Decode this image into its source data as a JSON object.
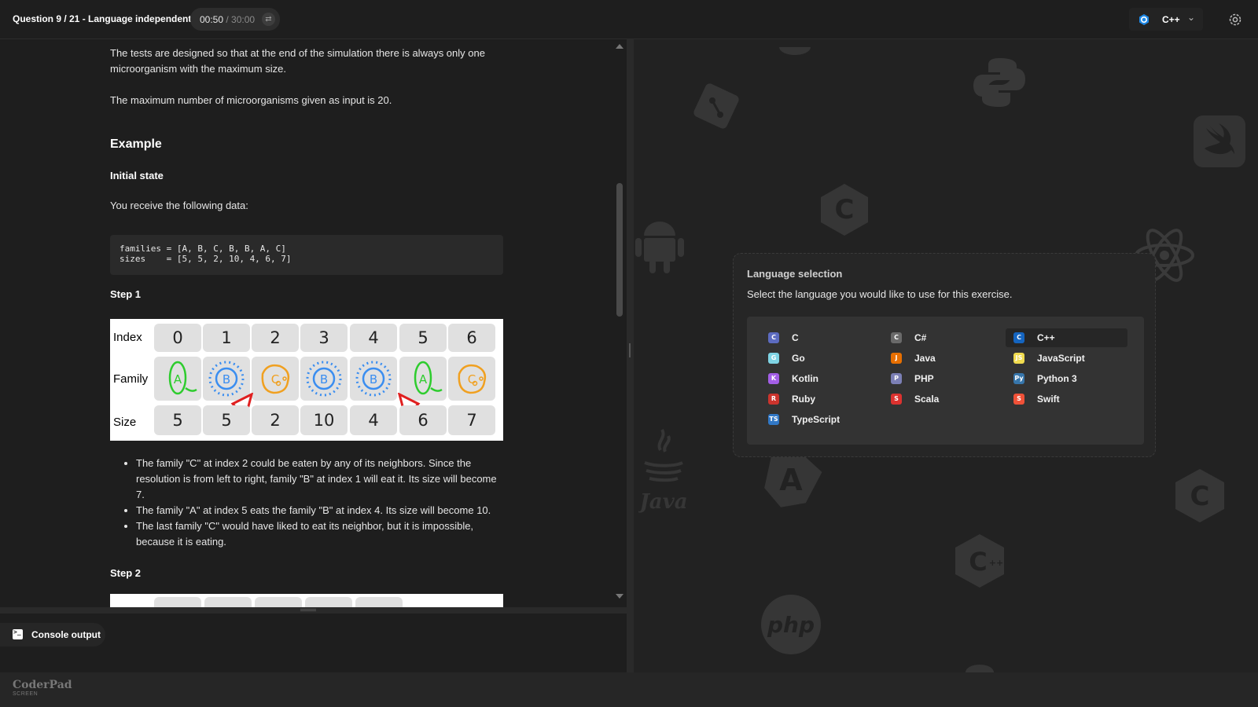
{
  "header": {
    "question_title": "Question 9 / 21 - Language independent",
    "timer_elapsed": "00:50",
    "timer_total": " / 30:00",
    "selected_language": "C++"
  },
  "problem": {
    "p1": "The tests are designed so that at the end of the simulation there is always only one microorganism with the maximum size.",
    "p2": "The maximum number of microorganisms given as input is 20.",
    "example_heading": "Example",
    "initial_state_heading": "Initial state",
    "p3": "You receive the following data:",
    "code_line1": "families = [A, B, C, B, B, A, C]",
    "code_line2": "sizes    = [5, 5, 2, 10, 4, 6, 7]",
    "step1_heading": "Step 1",
    "figure": {
      "row_labels": [
        "Index",
        "Family",
        "Size"
      ],
      "indices": [
        "0",
        "1",
        "2",
        "3",
        "4",
        "5",
        "6"
      ],
      "families": [
        "A",
        "B",
        "C",
        "B",
        "B",
        "A",
        "C"
      ],
      "sizes": [
        "5",
        "5",
        "2",
        "10",
        "4",
        "6",
        "7"
      ],
      "family_colors": {
        "A": "#2ecc2e",
        "B": "#3b8ef0",
        "C": "#f0a020"
      }
    },
    "bullets": [
      "The family \"C\" at index 2 could be eaten by any of its neighbors. Since the resolution is from left to right, family \"B\" at index 1 will eat it. Its size will become 7.",
      "The family \"A\" at index 5 eats the family \"B\" at index 4. Its size will become 10.",
      "The last family \"C\" would have liked to eat its neighbor, but it is impossible, because it is eating."
    ],
    "step2_heading": "Step 2"
  },
  "console": {
    "tab_label": "Console output"
  },
  "footer": {
    "logo": "CoderPad",
    "logo_sub": "SCREEN"
  },
  "language_selection": {
    "title": "Language selection",
    "subtitle": "Select the language you would like to use for this exercise.",
    "languages": [
      {
        "name": "C",
        "icon": "c-icon",
        "color": "#5c6bc0",
        "glyph": "C"
      },
      {
        "name": "C#",
        "icon": "csharp-icon",
        "color": "#6a6a6a",
        "glyph": "C"
      },
      {
        "name": "C++",
        "icon": "cpp-icon",
        "color": "#1565c0",
        "glyph": "C",
        "selected": true
      },
      {
        "name": "Go",
        "icon": "go-icon",
        "color": "#7fd4e4",
        "glyph": "G"
      },
      {
        "name": "Java",
        "icon": "java-icon",
        "color": "#e76f00",
        "glyph": "J"
      },
      {
        "name": "JavaScript",
        "icon": "javascript-icon",
        "color": "#f0db4f",
        "glyph": "JS"
      },
      {
        "name": "Kotlin",
        "icon": "kotlin-icon",
        "color": "#a35ee6",
        "glyph": "K"
      },
      {
        "name": "PHP",
        "icon": "php-icon",
        "color": "#7b7fb5",
        "glyph": "P"
      },
      {
        "name": "Python 3",
        "icon": "python-icon",
        "color": "#3776ab",
        "glyph": "Py"
      },
      {
        "name": "Ruby",
        "icon": "ruby-icon",
        "color": "#cc342d",
        "glyph": "R"
      },
      {
        "name": "Scala",
        "icon": "scala-icon",
        "color": "#dc322f",
        "glyph": "S"
      },
      {
        "name": "Swift",
        "icon": "swift-icon",
        "color": "#f05138",
        "glyph": "S"
      },
      {
        "name": "TypeScript",
        "icon": "typescript-icon",
        "color": "#3178c6",
        "glyph": "TS"
      }
    ]
  },
  "background_icons": [
    "php-icon",
    "java-icon",
    "android-icon",
    "python-icon",
    "swift-icon",
    "react-icon",
    "csharp-icon",
    "c-icon",
    "cpp-icon",
    "angular-icon",
    "git-icon"
  ]
}
